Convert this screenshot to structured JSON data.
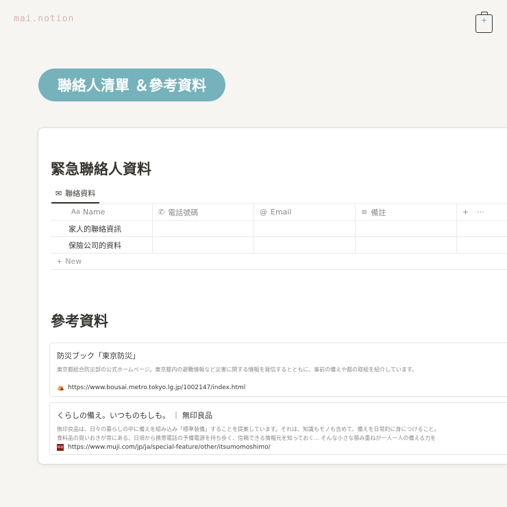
{
  "logo": "mai.notion",
  "banner": "聯絡人清單 ＆參考資料",
  "section1": {
    "title": "緊急聯絡人資料",
    "tab": "聯絡資料",
    "columns": [
      "Name",
      "電話號碼",
      "Email",
      "備註"
    ],
    "rows": [
      "家人的聯絡資訊",
      "保險公司的資料"
    ],
    "new_label": "New",
    "add": "+",
    "more": "···"
  },
  "section2": {
    "title": "參考資料",
    "bookmarks": [
      {
        "title": "防災ブック「東京防災」",
        "desc": [
          "東京都総合防災部の公式ホームページ。東京都内の避難情報など災害に関する情報を発信するとともに、事前の備えや都の取組を紹介しています。"
        ],
        "url": "https://www.bousai.metro.tokyo.lg.jp/1002147/index.html"
      },
      {
        "title": "くらしの備え。いつものもしも。 ｜ 無印良品",
        "desc": [
          "無印良品は、日々の暮らしの中に備えを組み込み「標準装備」することを提案しています。それは、知識もモノも含めて、備えを日常的に身につけること。",
          "食料品の買いおきが常にある、日頃から携帯電話の予備電源を持ち歩く、信頼できる情報元を知っておく... そんな小さな積み重ねが一人一人の備える力を"
        ],
        "url": "https://www.muji.com/jp/ja/special-feature/other/itsumomoshimo/",
        "favicon_text": "MUJI"
      }
    ]
  }
}
